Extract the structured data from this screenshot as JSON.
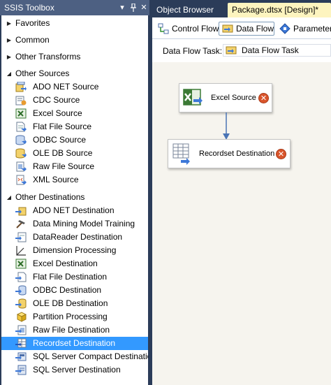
{
  "toolbox": {
    "title": "SSIS Toolbox",
    "menu_glyph": "▾",
    "pin_glyph": "ᛘ",
    "close_glyph": "✕",
    "categories": [
      {
        "label": "Favorites",
        "expanded": false
      },
      {
        "label": "Common",
        "expanded": false
      },
      {
        "label": "Other Transforms",
        "expanded": false
      },
      {
        "label": "Other Sources",
        "expanded": true
      },
      {
        "label": "Other Destinations",
        "expanded": true
      }
    ],
    "sources": [
      {
        "label": "ADO NET Source",
        "icon": "ado-net-source-icon"
      },
      {
        "label": "CDC Source",
        "icon": "cdc-source-icon"
      },
      {
        "label": "Excel Source",
        "icon": "excel-source-icon"
      },
      {
        "label": "Flat File Source",
        "icon": "flat-file-source-icon"
      },
      {
        "label": "ODBC Source",
        "icon": "odbc-source-icon"
      },
      {
        "label": "OLE DB Source",
        "icon": "ole-db-source-icon"
      },
      {
        "label": "Raw File Source",
        "icon": "raw-file-source-icon"
      },
      {
        "label": "XML Source",
        "icon": "xml-source-icon"
      }
    ],
    "destinations": [
      {
        "label": "ADO NET Destination",
        "icon": "ado-net-destination-icon"
      },
      {
        "label": "Data Mining Model Training",
        "icon": "data-mining-icon"
      },
      {
        "label": "DataReader Destination",
        "icon": "datareader-destination-icon"
      },
      {
        "label": "Dimension Processing",
        "icon": "dimension-processing-icon"
      },
      {
        "label": "Excel Destination",
        "icon": "excel-destination-icon"
      },
      {
        "label": "Flat File Destination",
        "icon": "flat-file-destination-icon"
      },
      {
        "label": "ODBC Destination",
        "icon": "odbc-destination-icon"
      },
      {
        "label": "OLE DB Destination",
        "icon": "ole-db-destination-icon"
      },
      {
        "label": "Partition Processing",
        "icon": "partition-processing-icon"
      },
      {
        "label": "Raw File Destination",
        "icon": "raw-file-destination-icon"
      },
      {
        "label": "Recordset Destination",
        "icon": "recordset-destination-icon",
        "selected": true
      },
      {
        "label": "SQL Server Compact Destination",
        "icon": "sql-compact-destination-icon"
      },
      {
        "label": "SQL Server Destination",
        "icon": "sql-server-destination-icon"
      }
    ]
  },
  "document_tabs": {
    "object_browser": "Object Browser",
    "package": "Package.dtsx [Design]*",
    "package_active": true
  },
  "designer": {
    "tabs": [
      {
        "label": "Control Flow",
        "icon": "control-flow-icon",
        "active": false
      },
      {
        "label": "Data Flow",
        "icon": "data-flow-icon",
        "active": true
      },
      {
        "label": "Parameters",
        "icon": "parameters-icon",
        "active": false
      }
    ],
    "task_label": "Data Flow Task:",
    "task_value": "Data Flow Task"
  },
  "canvas": {
    "components": [
      {
        "label": "Excel Source",
        "icon": "excel-source-icon",
        "has_error": true
      },
      {
        "label": "Recordset Destination",
        "icon": "recordset-destination-icon",
        "has_error": true
      }
    ],
    "error_glyph": "✕"
  },
  "colors": {
    "panel_background": "#2b3c59",
    "title_bar": "#4d6082",
    "selection": "#3399ff",
    "active_tab": "#fdf4bf",
    "canvas": "#f6f4ee",
    "error": "#d9542b"
  }
}
